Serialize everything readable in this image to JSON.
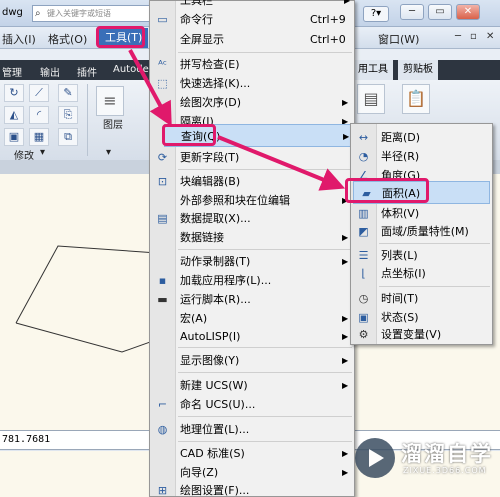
{
  "titlebar": {
    "filename": "dwg",
    "search_placeholder": "键入关键字或短语",
    "help": "?▾",
    "minimize": "─",
    "restore": "▭",
    "close": "✕"
  },
  "menubar": {
    "items": [
      "插入(I)",
      "格式(O)",
      "工具(T)",
      "窗口(W)"
    ],
    "doc_controls": [
      "─",
      "▫",
      "✕"
    ]
  },
  "ribbon_tabs": [
    "管理",
    "输出",
    "插件",
    "Autode",
    "用工具",
    "剪贴板"
  ],
  "ribbon": {
    "modify_label": "修改",
    "layer_label": "图层",
    "modify_arrow": "▾",
    "panel_arrow": "▾"
  },
  "command": {
    "coord_text": "781.7681"
  },
  "tools_menu": {
    "items": [
      {
        "label": "工具栏",
        "icon": "",
        "shortcut": "",
        "arrow": false
      },
      {
        "label": "命令行",
        "icon": "command-line-icon",
        "shortcut": "Ctrl+9",
        "arrow": false
      },
      {
        "label": "全屏显示",
        "icon": "",
        "shortcut": "Ctrl+0",
        "arrow": false
      },
      {
        "label": "拼写检查(E)",
        "icon": "spell-check-icon",
        "shortcut": "",
        "arrow": false
      },
      {
        "label": "快速选择(K)...",
        "icon": "quick-select-icon",
        "shortcut": "",
        "arrow": false
      },
      {
        "label": "绘图次序(D)",
        "icon": "",
        "shortcut": "",
        "arrow": true
      },
      {
        "label": "隔离(I)",
        "icon": "",
        "shortcut": "",
        "arrow": true
      },
      {
        "label": "查询(Q)",
        "icon": "",
        "shortcut": "",
        "arrow": true
      },
      {
        "label": "更新字段(T)",
        "icon": "update-field-icon",
        "shortcut": "",
        "arrow": false
      },
      {
        "label": "块编辑器(B)",
        "icon": "block-editor-icon",
        "shortcut": "",
        "arrow": false
      },
      {
        "label": "外部参照和块在位编辑",
        "icon": "",
        "shortcut": "",
        "arrow": true
      },
      {
        "label": "数据提取(X)...",
        "icon": "data-extract-icon",
        "shortcut": "",
        "arrow": false
      },
      {
        "label": "数据链接",
        "icon": "",
        "shortcut": "",
        "arrow": true
      },
      {
        "label": "动作录制器(T)",
        "icon": "",
        "shortcut": "",
        "arrow": true
      },
      {
        "label": "加载应用程序(L)...",
        "icon": "load-app-icon",
        "shortcut": "",
        "arrow": false
      },
      {
        "label": "运行脚本(R)...",
        "icon": "run-script-icon",
        "shortcut": "",
        "arrow": false
      },
      {
        "label": "宏(A)",
        "icon": "",
        "shortcut": "",
        "arrow": true
      },
      {
        "label": "AutoLISP(I)",
        "icon": "",
        "shortcut": "",
        "arrow": true
      },
      {
        "label": "显示图像(Y)",
        "icon": "",
        "shortcut": "",
        "arrow": true
      },
      {
        "label": "新建 UCS(W)",
        "icon": "",
        "shortcut": "",
        "arrow": true
      },
      {
        "label": "命名 UCS(U)...",
        "icon": "named-ucs-icon",
        "shortcut": "",
        "arrow": false
      },
      {
        "label": "地理位置(L)...",
        "icon": "geo-location-icon",
        "shortcut": "",
        "arrow": false
      },
      {
        "label": "CAD 标准(S)",
        "icon": "",
        "shortcut": "",
        "arrow": true
      },
      {
        "label": "向导(Z)",
        "icon": "",
        "shortcut": "",
        "arrow": true
      },
      {
        "label": "绘图设置(F)...",
        "icon": "drafting-settings-icon",
        "shortcut": "",
        "arrow": false
      }
    ]
  },
  "query_menu": {
    "items": [
      {
        "label": "距离(D)",
        "icon": "distance-icon"
      },
      {
        "label": "半径(R)",
        "icon": "radius-icon"
      },
      {
        "label": "角度(G)",
        "icon": "angle-icon"
      },
      {
        "label": "面积(A)",
        "icon": "area-icon"
      },
      {
        "label": "体积(V)",
        "icon": "volume-icon"
      },
      {
        "label": "面域/质量特性(M)",
        "icon": "mass-properties-icon"
      },
      {
        "label": "列表(L)",
        "icon": "list-icon"
      },
      {
        "label": "点坐标(I)",
        "icon": "point-coord-icon"
      },
      {
        "label": "时间(T)",
        "icon": "time-icon"
      },
      {
        "label": "状态(S)",
        "icon": "status-icon"
      },
      {
        "label": "设置变量(V)",
        "icon": "set-variable-icon"
      }
    ]
  },
  "watermark": {
    "brand": "溜溜自学",
    "url": "ZIXUE.3D66.COM"
  },
  "colors": {
    "highlight_callout": "#e0196b",
    "menu_highlight": "#c9dff6",
    "active_menu": "#3a6fb8"
  }
}
